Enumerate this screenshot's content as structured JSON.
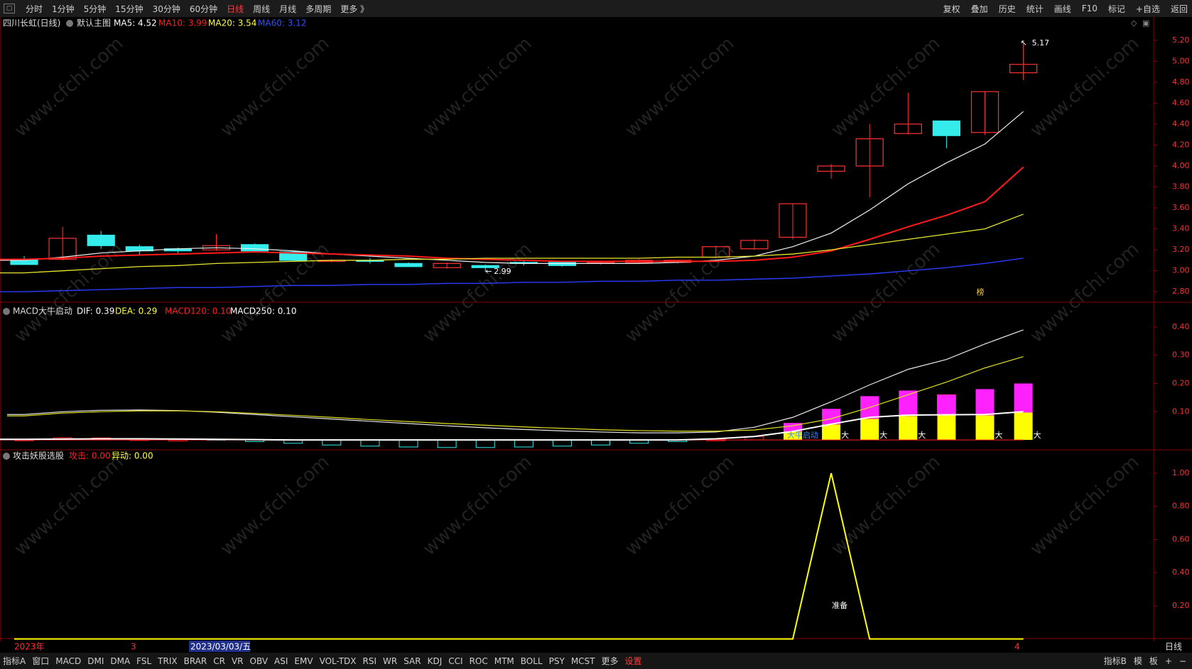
{
  "toolbar": {
    "window_icon": "▢",
    "timeframes": [
      "分时",
      "1分钟",
      "5分钟",
      "15分钟",
      "30分钟",
      "60分钟",
      "日线",
      "周线",
      "月线",
      "多周期",
      "更多 》"
    ],
    "active_timeframe": "日线",
    "right_buttons": [
      "复权",
      "叠加",
      "历史",
      "统计",
      "画线",
      "F10",
      "标记",
      "+自选",
      "返回"
    ]
  },
  "main_header": {
    "title": "四川长虹(日线)",
    "template": "默认主图",
    "ma": [
      {
        "label": "MA5: 4.52",
        "color": "#ffffff"
      },
      {
        "label": "MA10: 3.99",
        "color": "#ff2020"
      },
      {
        "label": "MA20: 3.54",
        "color": "#ffff40"
      },
      {
        "label": "MA60: 3.12",
        "color": "#3050ff"
      }
    ]
  },
  "macd_header": {
    "name": "MACD大牛启动",
    "items": [
      {
        "label": "DIF: 0.39",
        "color": "#ffffff"
      },
      {
        "label": "DEA: 0.29",
        "color": "#ffff40"
      },
      {
        "label": "MACD120: 0.10",
        "color": "#ff2020"
      },
      {
        "label": "MACD250: 0.10",
        "color": "#ffffff"
      }
    ]
  },
  "attack_header": {
    "name": "攻击妖股选股",
    "items": [
      {
        "label": "攻击: 0.00",
        "color": "#ff2020"
      },
      {
        "label": "异动: 0.00",
        "color": "#ffff40"
      }
    ]
  },
  "date_axis": {
    "year": "2023年",
    "tick_mid": "3",
    "cursor_date": "2023/03/03/五",
    "tick_right": "4",
    "period": "日线"
  },
  "watermark": "www.cfchi.com",
  "bottom_bar": {
    "left": [
      "指标A",
      "窗口",
      "MACD",
      "DMI",
      "DMA",
      "FSL",
      "TRIX",
      "BRAR",
      "CR",
      "VR",
      "OBV",
      "ASI",
      "EMV",
      "VOL-TDX",
      "RSI",
      "WR",
      "SAR",
      "KDJ",
      "CCI",
      "ROC",
      "MTM",
      "BOLL",
      "PSY",
      "MCST",
      "更多",
      "设置"
    ],
    "right": [
      "指标B",
      "模",
      "板",
      "+",
      "−"
    ]
  },
  "colors": {
    "up": "#ff3232",
    "down": "#35ecec",
    "ma5": "#f0f0f0",
    "ma10": "#ff1a1a",
    "ma20": "#e8e830",
    "ma60": "#2a3cff",
    "magenta": "#ff22ff",
    "yellow": "#ffff00",
    "grid": "#8a0000"
  },
  "chart_data": [
    {
      "type": "candlestick",
      "title": "四川长虹(日线)",
      "ylim": [
        2.7,
        5.3
      ],
      "yticks": [
        2.8,
        3.0,
        3.2,
        3.4,
        3.6,
        3.8,
        4.0,
        4.2,
        4.4,
        4.6,
        4.8,
        5.0,
        5.2
      ],
      "candles": [
        {
          "o": 3.11,
          "h": 3.14,
          "l": 3.06,
          "c": 3.06
        },
        {
          "o": 3.11,
          "h": 3.42,
          "l": 3.1,
          "c": 3.31
        },
        {
          "o": 3.34,
          "h": 3.38,
          "l": 3.21,
          "c": 3.24
        },
        {
          "o": 3.23,
          "h": 3.25,
          "l": 3.15,
          "c": 3.19
        },
        {
          "o": 3.21,
          "h": 3.22,
          "l": 3.17,
          "c": 3.19
        },
        {
          "o": 3.2,
          "h": 3.35,
          "l": 3.19,
          "c": 3.24
        },
        {
          "o": 3.25,
          "h": 3.26,
          "l": 3.18,
          "c": 3.19
        },
        {
          "o": 3.18,
          "h": 3.19,
          "l": 3.1,
          "c": 3.1
        },
        {
          "o": 3.09,
          "h": 3.11,
          "l": 3.08,
          "c": 3.1
        },
        {
          "o": 3.1,
          "h": 3.12,
          "l": 3.07,
          "c": 3.09
        },
        {
          "o": 3.07,
          "h": 3.08,
          "l": 3.04,
          "c": 3.04
        },
        {
          "o": 3.03,
          "h": 3.08,
          "l": 3.02,
          "c": 3.07
        },
        {
          "o": 3.05,
          "h": 3.06,
          "l": 2.99,
          "c": 3.03
        },
        {
          "o": 3.08,
          "h": 3.1,
          "l": 3.05,
          "c": 3.07
        },
        {
          "o": 3.08,
          "h": 3.09,
          "l": 3.04,
          "c": 3.05
        },
        {
          "o": 3.07,
          "h": 3.09,
          "l": 3.06,
          "c": 3.08
        },
        {
          "o": 3.08,
          "h": 3.11,
          "l": 3.07,
          "c": 3.1
        },
        {
          "o": 3.08,
          "h": 3.1,
          "l": 3.07,
          "c": 3.1
        },
        {
          "o": 3.13,
          "h": 3.24,
          "l": 3.12,
          "c": 3.23
        },
        {
          "o": 3.21,
          "h": 3.3,
          "l": 3.2,
          "c": 3.29
        },
        {
          "o": 3.32,
          "h": 3.64,
          "l": 3.3,
          "c": 3.64
        },
        {
          "o": 3.95,
          "h": 4.02,
          "l": 3.88,
          "c": 4.0
        },
        {
          "o": 4.0,
          "h": 4.4,
          "l": 3.7,
          "c": 4.26
        },
        {
          "o": 4.31,
          "h": 4.7,
          "l": 4.3,
          "c": 4.4
        },
        {
          "o": 4.43,
          "h": 4.43,
          "l": 4.17,
          "c": 4.29
        },
        {
          "o": 4.32,
          "h": 4.71,
          "l": 4.3,
          "c": 4.71
        },
        {
          "o": 4.89,
          "h": 5.17,
          "l": 4.82,
          "c": 4.97
        }
      ],
      "series": [
        {
          "name": "MA5",
          "values": [
            3.1,
            3.13,
            3.17,
            3.19,
            3.21,
            3.22,
            3.21,
            3.19,
            3.16,
            3.14,
            3.12,
            3.1,
            3.08,
            3.07,
            3.07,
            3.07,
            3.07,
            3.08,
            3.1,
            3.14,
            3.23,
            3.36,
            3.58,
            3.83,
            4.03,
            4.21,
            4.52
          ]
        },
        {
          "name": "MA10",
          "values": [
            3.11,
            3.12,
            3.14,
            3.15,
            3.16,
            3.17,
            3.18,
            3.17,
            3.16,
            3.15,
            3.14,
            3.12,
            3.11,
            3.1,
            3.09,
            3.09,
            3.09,
            3.09,
            3.09,
            3.1,
            3.13,
            3.19,
            3.3,
            3.42,
            3.53,
            3.66,
            3.99
          ]
        },
        {
          "name": "MA20",
          "values": [
            2.98,
            3.0,
            3.02,
            3.04,
            3.05,
            3.07,
            3.08,
            3.09,
            3.1,
            3.1,
            3.11,
            3.11,
            3.12,
            3.12,
            3.12,
            3.12,
            3.12,
            3.13,
            3.13,
            3.14,
            3.16,
            3.2,
            3.25,
            3.3,
            3.35,
            3.4,
            3.54
          ]
        },
        {
          "name": "MA60",
          "values": [
            2.8,
            2.81,
            2.82,
            2.83,
            2.84,
            2.84,
            2.85,
            2.86,
            2.86,
            2.87,
            2.87,
            2.88,
            2.88,
            2.89,
            2.89,
            2.9,
            2.9,
            2.91,
            2.91,
            2.92,
            2.93,
            2.95,
            2.97,
            3.0,
            3.03,
            3.07,
            3.12
          ]
        }
      ],
      "annotations": [
        {
          "text": "5.17",
          "candle": 26
        },
        {
          "text": "2.99",
          "candle": 12
        },
        {
          "text": "榜",
          "candle": 25
        }
      ]
    },
    {
      "type": "bar",
      "title": "MACD大牛启动",
      "ylim": [
        -0.035,
        0.43
      ],
      "yticks": [
        0.1,
        0.2,
        0.3,
        0.4
      ],
      "macd_bars": [
        0.002,
        0.008,
        0.007,
        0.003,
        0.001,
        -0.001,
        -0.006,
        -0.012,
        -0.018,
        -0.022,
        -0.025,
        -0.027,
        -0.027,
        -0.025,
        -0.022,
        -0.018,
        -0.012,
        -0.006,
        0.002,
        0.012,
        0.06,
        0.11,
        0.155,
        0.175,
        0.16,
        0.18,
        0.2
      ],
      "macd_lower": [
        0,
        0,
        0,
        0,
        0,
        0,
        0,
        0,
        0,
        0,
        0,
        0,
        0,
        0,
        0,
        0,
        0,
        0,
        0,
        0,
        0.03,
        0.055,
        0.075,
        0.085,
        0.087,
        0.087,
        0.097
      ],
      "series": [
        {
          "name": "DIF",
          "values": [
            0.09,
            0.1,
            0.105,
            0.106,
            0.104,
            0.098,
            0.09,
            0.082,
            0.074,
            0.066,
            0.058,
            0.05,
            0.043,
            0.037,
            0.032,
            0.028,
            0.025,
            0.025,
            0.028,
            0.045,
            0.08,
            0.135,
            0.195,
            0.25,
            0.285,
            0.34,
            0.39
          ]
        },
        {
          "name": "DEA",
          "values": [
            0.085,
            0.095,
            0.1,
            0.103,
            0.103,
            0.1,
            0.094,
            0.087,
            0.08,
            0.072,
            0.065,
            0.058,
            0.052,
            0.046,
            0.041,
            0.036,
            0.033,
            0.031,
            0.031,
            0.035,
            0.05,
            0.075,
            0.115,
            0.16,
            0.205,
            0.255,
            0.295
          ]
        },
        {
          "name": "MACD250",
          "values": [
            0.002,
            0.003,
            0.004,
            0.004,
            0.003,
            0.002,
            0.001,
            0.0,
            0.0,
            0.0,
            0.0,
            0.0,
            0.0,
            0.0,
            0.0,
            0.0,
            0.0,
            0.0,
            0.004,
            0.012,
            0.03,
            0.056,
            0.08,
            0.088,
            0.089,
            0.09,
            0.1
          ]
        }
      ],
      "labels": [
        {
          "text": "大牛启动",
          "candle": 20
        },
        {
          "text": "大",
          "candle": 21
        },
        {
          "text": "大",
          "candle": 22
        },
        {
          "text": "大",
          "candle": 23
        },
        {
          "text": "大",
          "candle": 25
        },
        {
          "text": "大",
          "candle": 26
        }
      ]
    },
    {
      "type": "line",
      "title": "攻击妖股选股",
      "ylim": [
        -0.01,
        1.06
      ],
      "yticks": [
        0.2,
        0.4,
        0.6,
        0.8,
        1.0
      ],
      "series": [
        {
          "name": "异动",
          "values": [
            0,
            0,
            0,
            0,
            0,
            0,
            0,
            0,
            0,
            0,
            0,
            0,
            0,
            0,
            0,
            0,
            0,
            0,
            0,
            0,
            0,
            1,
            0,
            0,
            0,
            0,
            0
          ]
        }
      ],
      "labels": [
        {
          "text": "准备",
          "candle": 21
        }
      ]
    }
  ]
}
